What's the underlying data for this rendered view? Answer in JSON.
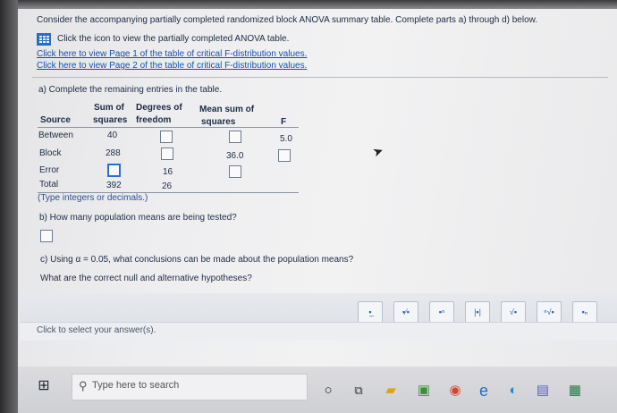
{
  "question": {
    "intro": "Consider the accompanying partially completed randomized block ANOVA summary table. Complete parts a) through d) below.",
    "icon_link": "Click the icon to view the partially completed ANOVA table.",
    "link1": "Click here to view Page 1 of the table of critical F-distribution values.",
    "link2": "Click here to view Page 2 of the table of critical F-distribution values."
  },
  "part_a": {
    "label": "a) Complete the remaining entries in the table.",
    "headers": {
      "source": "Source",
      "ss_line1": "Sum of",
      "ss_line2": "squares",
      "df_line1": "Degrees of",
      "df_line2": "freedom",
      "ms_line1": "Mean sum of",
      "ms_line2": "squares",
      "f": "F"
    },
    "rows": [
      {
        "source": "Between",
        "ss": "40",
        "df": "",
        "ms": "",
        "f": "5.0"
      },
      {
        "source": "Block",
        "ss": "288",
        "df": "",
        "ms": "36.0",
        "f": ""
      },
      {
        "source": "Error",
        "ss": "",
        "df": "16",
        "ms": "",
        "f": ""
      },
      {
        "source": "Total",
        "ss": "392",
        "df": "26",
        "ms": "",
        "f": ""
      }
    ],
    "hint": "(Type integers or decimals.)"
  },
  "part_b": {
    "label": "b) How many population means are being tested?"
  },
  "part_c": {
    "label": "c) Using α = 0.05, what conclusions can be made about the population means?",
    "sub": "What are the correct null and alternative hypotheses?"
  },
  "answer_prompt": "Click to select your answer(s).",
  "taskbar": {
    "search_placeholder": "Type here to search"
  },
  "colors": {
    "link": "#1a4fa8",
    "accent": "#2d6fd1",
    "text": "#1d2a44"
  }
}
